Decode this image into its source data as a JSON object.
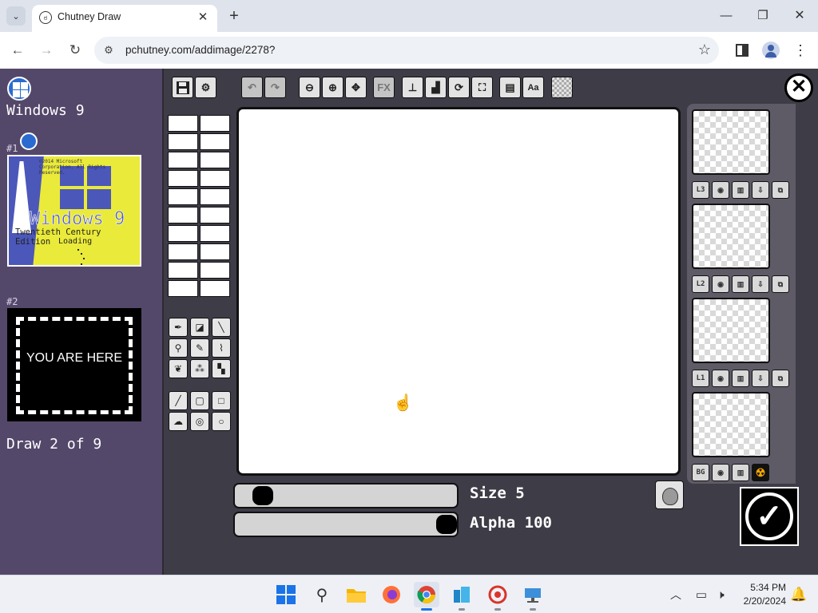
{
  "browser": {
    "tab_title": "Chutney Draw",
    "url": "pchutney.com/addimage/2278?",
    "icons": [
      "tab-list-icon",
      "tab-favicon-icon",
      "close-icon",
      "plus-icon",
      "minimize-icon",
      "maximize-icon",
      "close-window-icon",
      "back-icon",
      "forward-icon",
      "reload-icon",
      "site-info-icon",
      "star-icon",
      "side-panel-icon",
      "profile-icon",
      "more-vert-icon"
    ]
  },
  "project": {
    "title": "Windows 9",
    "draw_count": "Draw 2 of 9"
  },
  "frames": [
    {
      "label": "#1",
      "copyright": "©2014 Microsoft Corporation. All Rights Reserved.",
      "heading": "Windows 9",
      "subtitle": "Twentieth Century Edition",
      "status": "Loading"
    },
    {
      "label": "#2",
      "placeholder": "YOU ARE HERE"
    }
  ],
  "toolbar": {
    "fx_label": "FX",
    "text_label": "Aa",
    "icons": [
      "save-icon",
      "settings-icon",
      "undo-icon",
      "redo-icon",
      "zoom-out-icon",
      "zoom-in-icon",
      "move-icon",
      "fx-icon",
      "stamp-icon",
      "bucket-icon",
      "rotate-icon",
      "crop-icon",
      "image-icon",
      "text-icon",
      "transparency-icon"
    ]
  },
  "tools": {
    "icons": [
      "pen-icon",
      "eraser-icon",
      "brush-icon",
      "dropper-icon",
      "pencil-icon",
      "airbrush-icon",
      "fill-icon",
      "spray-icon",
      "dither-icon",
      "line-icon",
      "rect-outline-icon",
      "rect-fill-icon",
      "blob-icon",
      "circle-outline-icon",
      "circle-fill-icon"
    ]
  },
  "sliders": {
    "size_label": "Size 5",
    "alpha_label": "Alpha 100",
    "size_value": 5,
    "alpha_value": 100
  },
  "layers": [
    {
      "label": "L3"
    },
    {
      "label": "L2"
    },
    {
      "label": "L1"
    },
    {
      "label": "BG"
    }
  ],
  "taskbar": {
    "time": "5:34 PM",
    "date": "2/20/2024",
    "apps": [
      "start",
      "search",
      "file-explorer",
      "firefox",
      "chrome",
      "app-blue",
      "app-red",
      "app-network"
    ]
  },
  "colors": {
    "page_bg": "#3e3c47",
    "left_panel": "#54486a",
    "frame_yellow": "#eaea3a",
    "frame_blue": "#4b57b9"
  }
}
